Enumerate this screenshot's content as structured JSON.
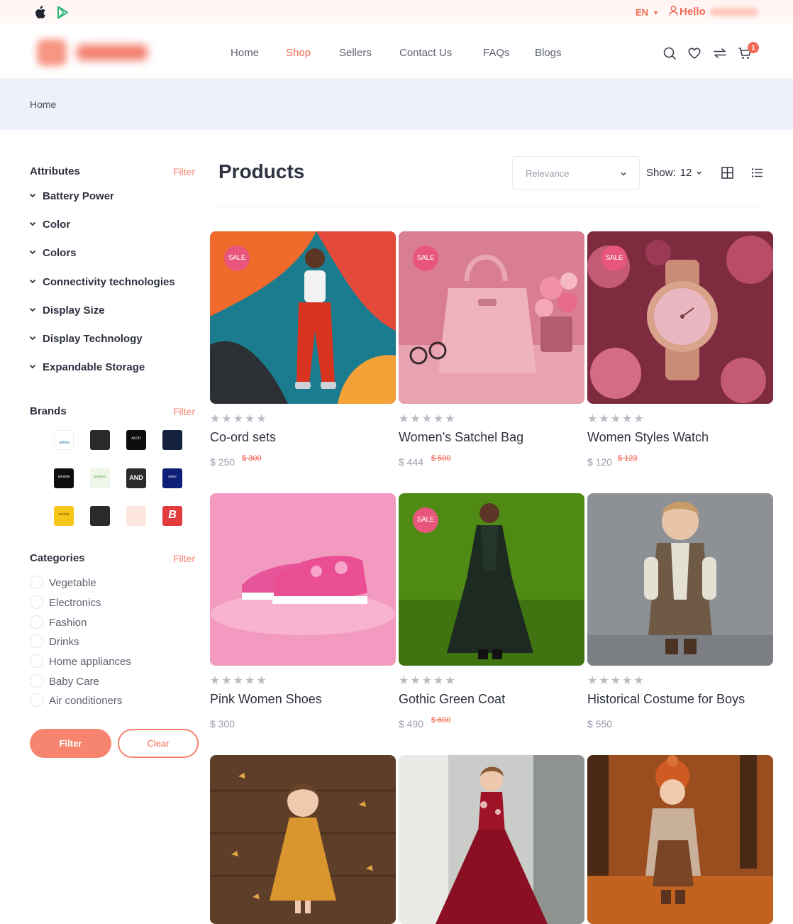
{
  "topbar": {
    "lang": "EN",
    "hello": "Hello"
  },
  "nav": [
    {
      "label": "Home",
      "active": false
    },
    {
      "label": "Shop",
      "active": true
    },
    {
      "label": "Sellers",
      "active": false
    },
    {
      "label": "Contact Us",
      "active": false
    },
    {
      "label": "FAQs",
      "active": false
    },
    {
      "label": "Blogs",
      "active": false
    }
  ],
  "header_icons": [
    "search-icon",
    "heart-icon",
    "compare-icon",
    "cart-icon"
  ],
  "cart": {
    "count": "1"
  },
  "breadcrumb": "Home",
  "sidebar": {
    "attributes": {
      "title": "Attributes",
      "filter": "Filter",
      "items": [
        "Battery Power",
        "Color",
        "Colors",
        "Connectivity technologies",
        "Display Size",
        "Display Technology",
        "Expandable Storage"
      ]
    },
    "brands": {
      "title": "Brands",
      "filter": "Filter",
      "items": [
        {
          "name": "adidas",
          "label": "adidas",
          "bg": "#ffffff",
          "fg": "#1b7fa7"
        },
        {
          "name": "brand-red",
          "label": "",
          "bg": "#2a2a2a",
          "fg": "#e23b3b"
        },
        {
          "name": "aldo",
          "label": "ALDO",
          "bg": "#0d0d0d",
          "fg": "#ffffff"
        },
        {
          "name": "alen-solly",
          "label": "",
          "bg": "#15223d",
          "fg": "#9fb2d6"
        },
        {
          "name": "amante",
          "label": "amante",
          "bg": "#0d0d0d",
          "fg": "#ffffff"
        },
        {
          "name": "aswiten",
          "label": "aswiten",
          "bg": "#eef6ea",
          "fg": "#6aaa4c"
        },
        {
          "name": "and",
          "label": "AND",
          "bg": "#2a2a2a",
          "fg": "#ffffff"
        },
        {
          "name": "asics",
          "label": "asics",
          "bg": "#0e1f77",
          "fg": "#ffffff"
        },
        {
          "name": "aurelia",
          "label": "aurelia",
          "bg": "#f6c518",
          "fg": "#6a4b0c"
        },
        {
          "name": "brand-dark",
          "label": "",
          "bg": "#2a2a2a",
          "fg": "#ffffff"
        },
        {
          "name": "brand-peach",
          "label": "",
          "bg": "#fde6dd",
          "fg": "#f6b37a"
        },
        {
          "name": "brand-b",
          "label": "B",
          "bg": "#e23b3b",
          "fg": "#ffffff"
        }
      ]
    },
    "categories": {
      "title": "Categories",
      "filter": "Filter",
      "items": [
        "Vegetable",
        "Electronics",
        "Fashion",
        "Drinks",
        "Home appliances",
        "Baby Care",
        "Air conditioners"
      ]
    },
    "buttons": {
      "filter": "Filter",
      "clear": "Clear"
    }
  },
  "main": {
    "title": "Products",
    "sort": {
      "value": "Relevance"
    },
    "show": {
      "label": "Show:",
      "value": "12"
    },
    "products": [
      {
        "name": "Co-ord sets",
        "price": "$ 250",
        "old": "$ 300",
        "sale": true
      },
      {
        "name": "Women's Satchel Bag",
        "price": "$ 444",
        "old": "$ 500",
        "sale": true
      },
      {
        "name": "Women Styles Watch",
        "price": "$ 120",
        "old": "$ 123",
        "sale": true
      },
      {
        "name": "Pink Women Shoes",
        "price": "$ 300",
        "old": "",
        "sale": false
      },
      {
        "name": "Gothic Green Coat",
        "price": "$ 490",
        "old": "$ 600",
        "sale": true
      },
      {
        "name": "Historical Costume for Boys",
        "price": "$ 550",
        "old": "",
        "sale": false
      },
      {
        "name": "",
        "price": "",
        "old": "",
        "sale": false
      },
      {
        "name": "",
        "price": "",
        "old": "",
        "sale": false
      },
      {
        "name": "",
        "price": "",
        "old": "",
        "sale": false
      }
    ],
    "sale_label": "SALE",
    "stars": "★★★★★"
  }
}
